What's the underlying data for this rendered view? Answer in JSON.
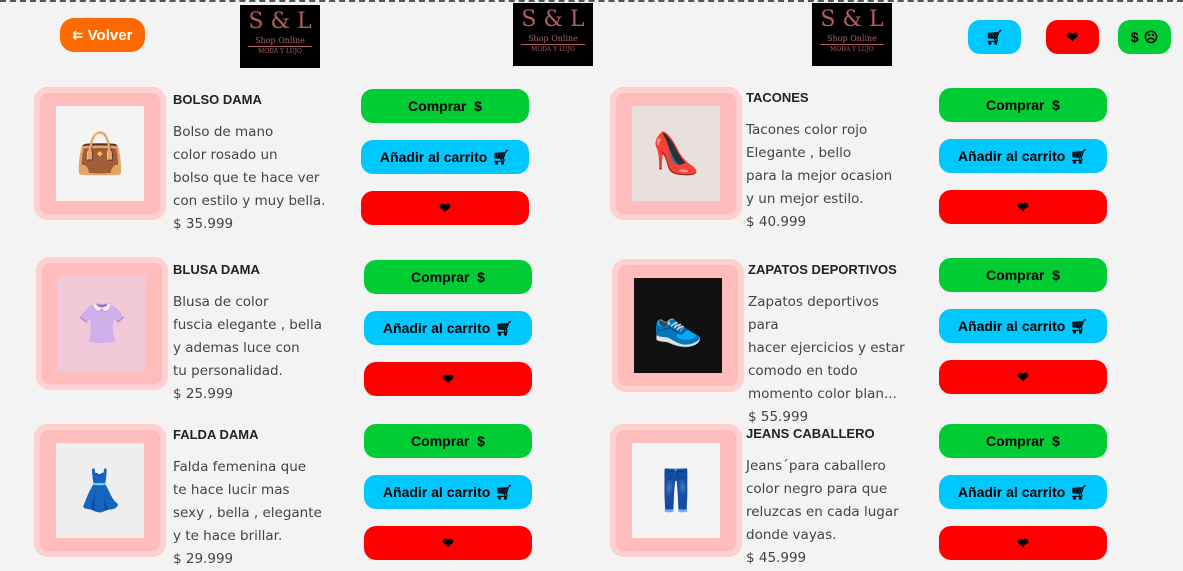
{
  "header": {
    "back_label": "Volver",
    "back_icon": "back-arrow-icon",
    "logo": {
      "title": "S & L",
      "subtitle": "Shop Online",
      "tagline": "MODA Y LUJO"
    },
    "cart_icon": "cart-icon",
    "heart_icon": "heart-icon",
    "money_label": "$",
    "money_icon": "money-face-icon"
  },
  "buttons": {
    "buy": "Comprar  $",
    "add_cart": "Añadir al carrito",
    "heart": "❤"
  },
  "colors": {
    "buy": "#00cc33",
    "cart": "#00c8ff",
    "fav": "#ff0000",
    "back": "#ff6a00"
  },
  "products": [
    {
      "title": "BOLSO DAMA",
      "desc": [
        "Bolso de mano",
        "color rosado un",
        "bolso que te hace ver",
        "con estilo y muy bella."
      ],
      "price": "$ 35.999"
    },
    {
      "title": "TACONES",
      "desc": [
        "Tacones color rojo",
        "Elegante , bello",
        "para la mejor ocasion",
        "y un mejor estilo."
      ],
      "price": "$ 40.999"
    },
    {
      "title": "BLUSA DAMA",
      "desc": [
        "Blusa de color",
        "fuscia elegante , bella",
        "y ademas luce con",
        "tu personalidad."
      ],
      "price": "$ 25.999"
    },
    {
      "title": "ZAPATOS DEPORTIVOS",
      "desc": [
        "Zapatos deportivos para",
        "hacer ejercicios y estar",
        "comodo en todo",
        "momento color blan..."
      ],
      "price": "$ 55.999"
    },
    {
      "title": "FALDA DAMA",
      "desc": [
        "Falda femenina que",
        "te hace lucir mas",
        "sexy , bella , elegante",
        "y te hace brillar."
      ],
      "price": "$ 29.999"
    },
    {
      "title": "JEANS CABALLERO",
      "desc": [
        "Jeans´para caballero",
        "color negro para que",
        "reluzcas en cada lugar",
        "donde vayas."
      ],
      "price": "$ 45.999"
    }
  ]
}
